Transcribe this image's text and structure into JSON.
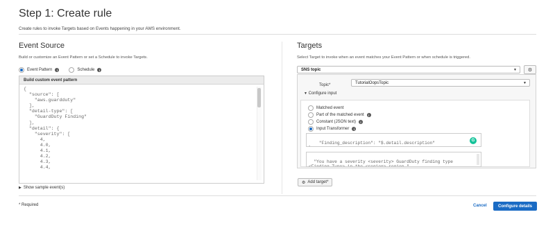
{
  "page": {
    "title": "Step 1: Create rule",
    "subtitle": "Create rules to invoke Targets based on Events happening in your AWS environment."
  },
  "event_source": {
    "title": "Event Source",
    "description": "Build or customize an Event Pattern or set a Schedule to invoke Targets.",
    "options": [
      {
        "label": "Event Pattern",
        "selected": true
      },
      {
        "label": "Schedule",
        "selected": false
      }
    ],
    "pattern_select": "Build custom event pattern",
    "code": "{\n  \"source\": [\n    \"aws.guardduty\"\n  ],\n  \"detail-type\": [\n    \"GuardDuty Finding\"\n  ],\n  \"detail\": {\n    \"severity\": [\n      4,\n      4.0,\n      4.1,\n      4.2,\n      4.3,\n      4.4,",
    "show_sample": "Show sample event(s)"
  },
  "targets": {
    "title": "Targets",
    "description": "Select Target to invoke when an event matches your Event Pattern or when schedule is triggered.",
    "target_type": "SNS topic",
    "topic_label": "Topic*",
    "topic_value": "TutorialOopsTopic",
    "configure_input": "Configure input",
    "input_options": [
      {
        "label": "Matched event",
        "selected": false,
        "info": false
      },
      {
        "label": "Part of the matched event",
        "selected": false,
        "info": true
      },
      {
        "label": "Constant (JSON text)",
        "selected": false,
        "info": true
      },
      {
        "label": "Input Transformer",
        "selected": true,
        "info": true
      }
    ],
    "input_paths_code": "  \"Finding_description\": \"$.detail.description\"\n}",
    "input_template_code": "\"You have a severity <severity> GuardDuty finding type\n<Finding_Type> in the <region> region.\"",
    "add_target": "Add target*"
  },
  "footer": {
    "required": "* Required",
    "cancel": "Cancel",
    "configure": "Configure details"
  },
  "colors": {
    "primary": "#1a6bc4",
    "grammarly": "#15c39a"
  }
}
